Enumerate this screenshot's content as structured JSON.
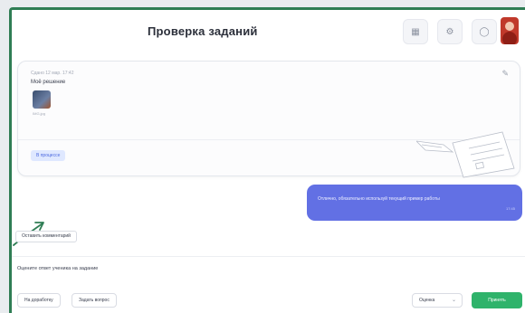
{
  "header": {
    "title": "Проверка заданий",
    "icons": [
      "grid-icon",
      "settings-icon",
      "bell-icon"
    ]
  },
  "task": {
    "date": "Сдано 12 мар. 17:42",
    "text": "Моё решение",
    "attachment_caption": "IMG.jpg",
    "tag_label": "В процессе"
  },
  "chat": {
    "message": "Отлично, обязательно используй текущий пример работы",
    "time": "17:45"
  },
  "comment_chip": "Оставить комментарий",
  "prompt": "Оцените ответ ученика на задание",
  "actions": {
    "btn_left_1": "На доработку",
    "btn_left_2": "Задать вопрос",
    "select_value": "Оценка",
    "primary": "Принять"
  },
  "colors": {
    "accent_blue": "#6270e4",
    "accent_green": "#2fb36b",
    "arrow_green": "#2f7d54"
  }
}
